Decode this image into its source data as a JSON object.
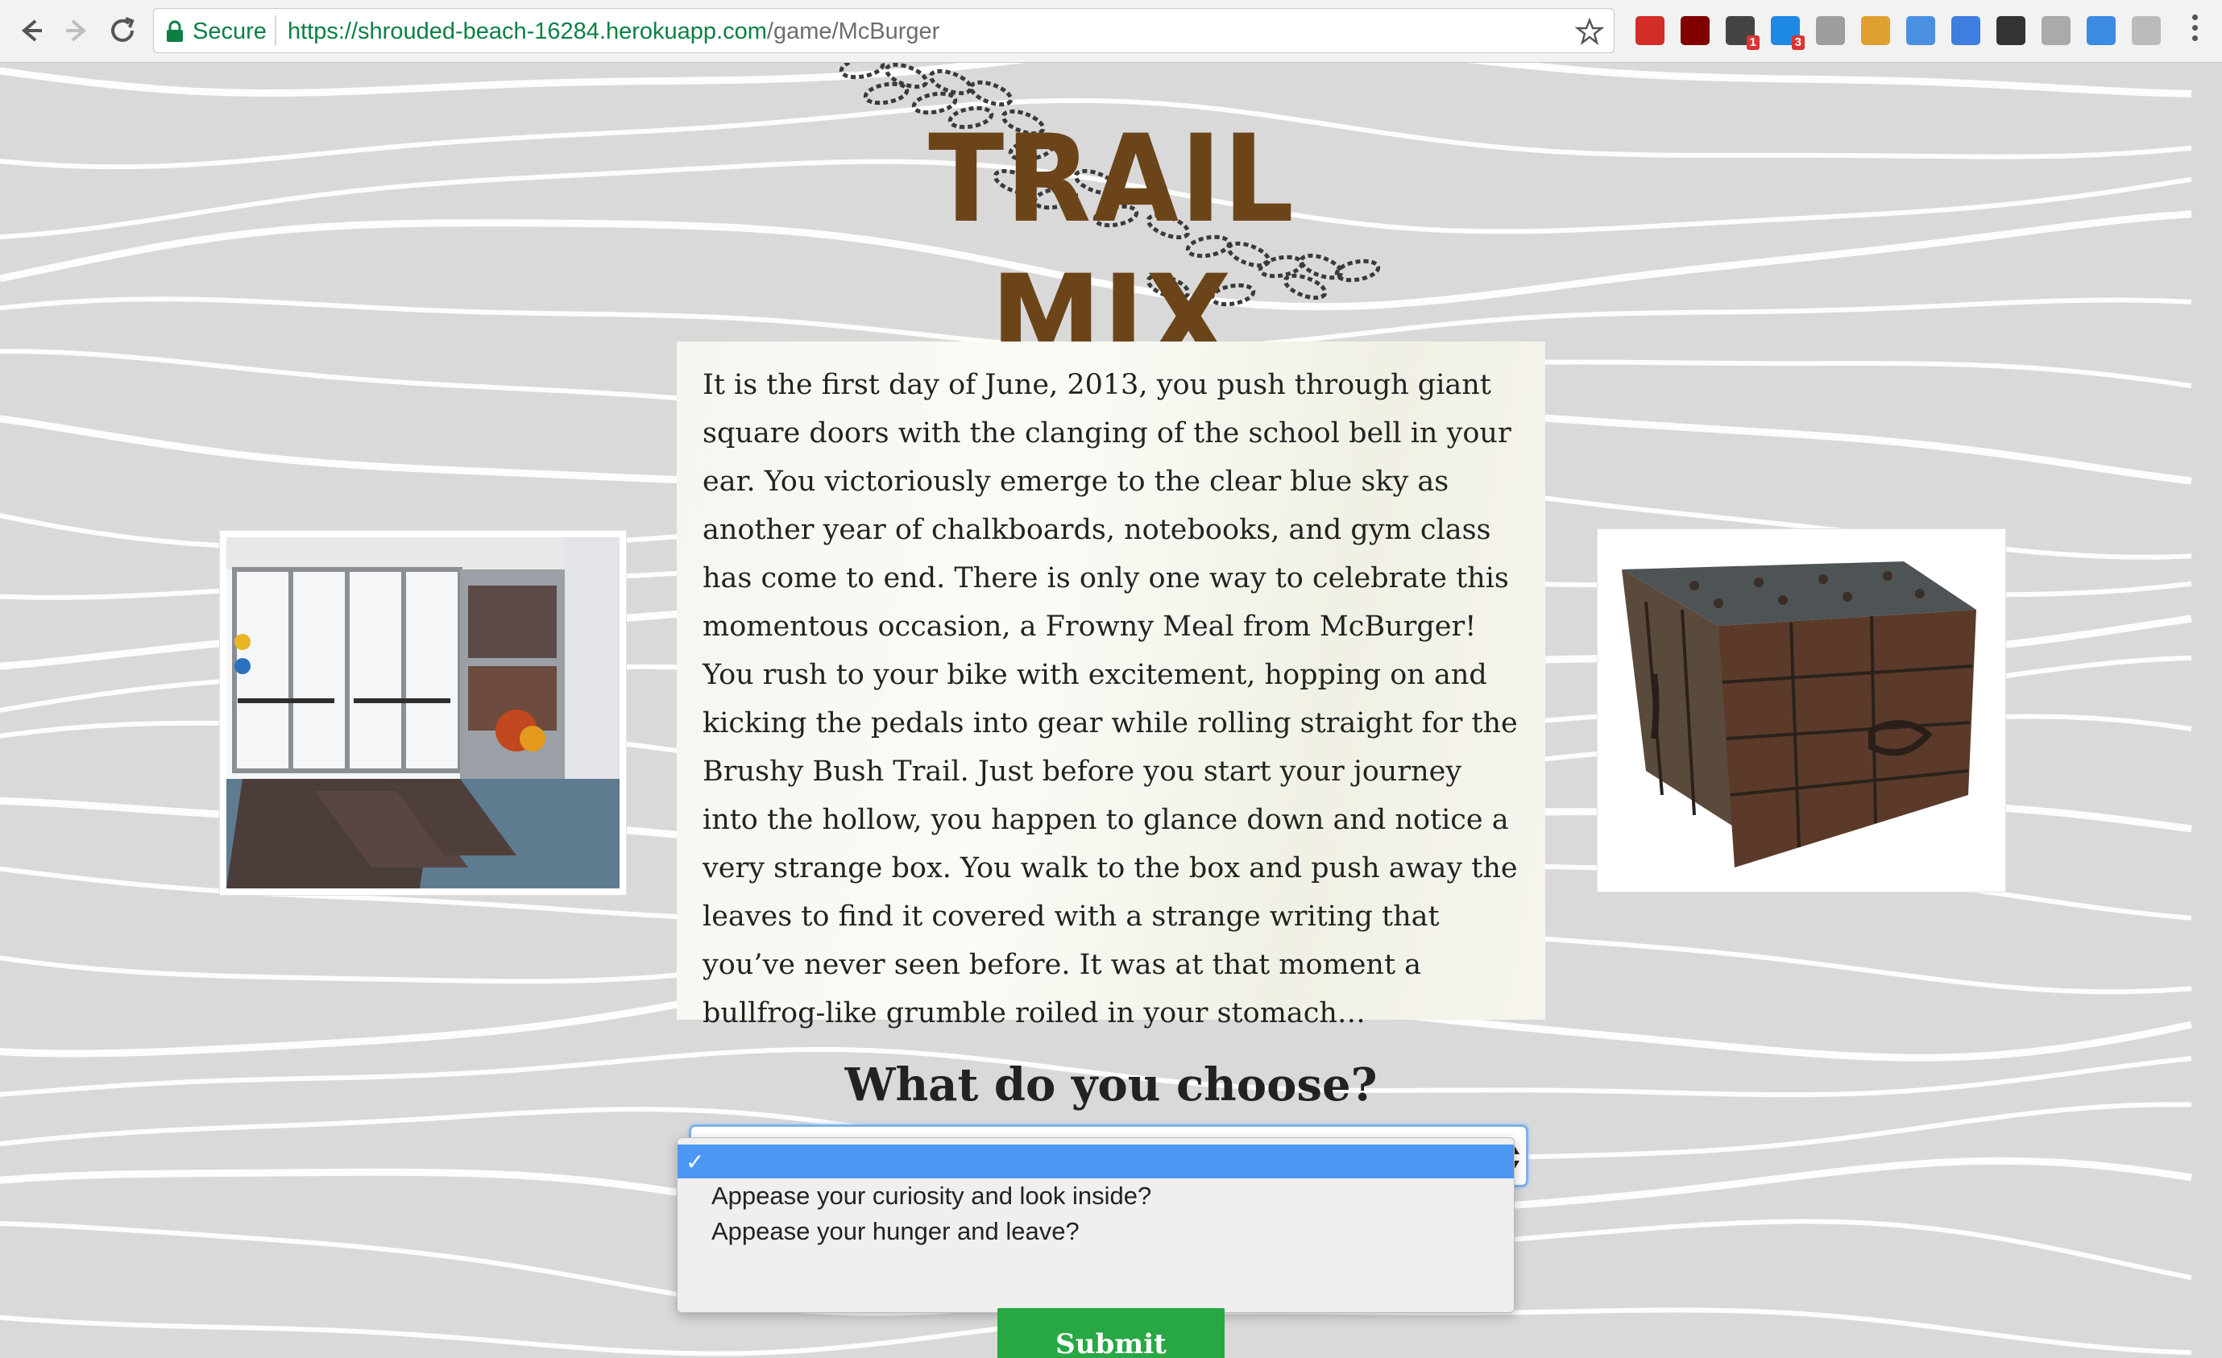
{
  "browser": {
    "secure_label": "Secure",
    "url_host": "https://shrouded-beach-16284.herokuapp.com",
    "url_path": "/game/McBurger",
    "extensions": [
      {
        "name": "lastpass-icon",
        "color": "#d32d27",
        "badge": ""
      },
      {
        "name": "ublock-icon",
        "color": "#800000",
        "badge": ""
      },
      {
        "name": "extension-a-icon",
        "color": "#444444",
        "badge": "1"
      },
      {
        "name": "skype-icon",
        "color": "#1e88e5",
        "badge": "3"
      },
      {
        "name": "table-icon",
        "color": "#9e9e9e",
        "badge": ""
      },
      {
        "name": "ruler-icon",
        "color": "#e0a030",
        "badge": ""
      },
      {
        "name": "eyedropper-icon",
        "color": "#4a90e2",
        "badge": ""
      },
      {
        "name": "arrows-icon",
        "color": "#3d7ee0",
        "badge": ""
      },
      {
        "name": "screenshot-icon",
        "color": "#333333",
        "badge": ""
      },
      {
        "name": "circle-icon",
        "color": "#aaaaaa",
        "badge": ""
      },
      {
        "name": "resize-icon",
        "color": "#3b8be3",
        "badge": ""
      },
      {
        "name": "rss-icon",
        "color": "#bbbbbb",
        "badge": ""
      }
    ]
  },
  "logo": {
    "text": "TRAIL MIX",
    "color": "#6b4519"
  },
  "story": {
    "text": "It is the first day of June, 2013, you push through giant square doors with the clanging of the school bell in your ear. You victoriously emerge to the clear blue sky as another year of chalkboards, notebooks, and gym class has come to end. There is only one way to celebrate this momentous occasion, a Frowny Meal from McBurger! You rush to your bike with excitement, hopping on and kicking the pedals into gear while rolling straight for the Brushy Bush Trail. Just before you start your journey into the hollow, you happen to glance down and notice a very strange box. You walk to the box and push away the leaves to find it covered with a strange writing that you’ve never seen before. It was at that moment a bullfrog-like grumble roiled in your stomach…"
  },
  "question": "What do you choose?",
  "choices": {
    "selected": "",
    "options": [
      "Appease your curiosity and look inside?",
      "Appease your hunger and leave?"
    ]
  },
  "submit_label": "Submit Answer",
  "colors": {
    "accent": "#28a745",
    "select_highlight": "#4c97f4"
  }
}
